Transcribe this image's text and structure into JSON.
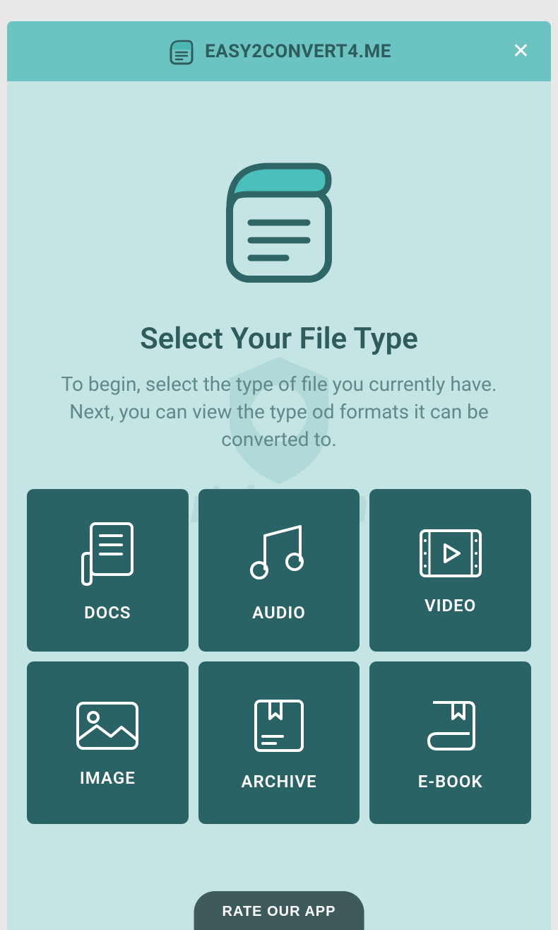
{
  "header": {
    "title": "EASY2CONVERT4.ME"
  },
  "main": {
    "title": "Select Your File Type",
    "subtitle": "To begin, select the type of file you currently have. Next, you can view the type od formats it can be converted to."
  },
  "tiles": [
    {
      "label": "DOCS"
    },
    {
      "label": "AUDIO"
    },
    {
      "label": "VIDEO"
    },
    {
      "label": "IMAGE"
    },
    {
      "label": "ARCHIVE"
    },
    {
      "label": "E-BOOK"
    }
  ],
  "footer": {
    "rate_label": "RATE OUR APP"
  },
  "watermark": {
    "text": "risk.com"
  }
}
